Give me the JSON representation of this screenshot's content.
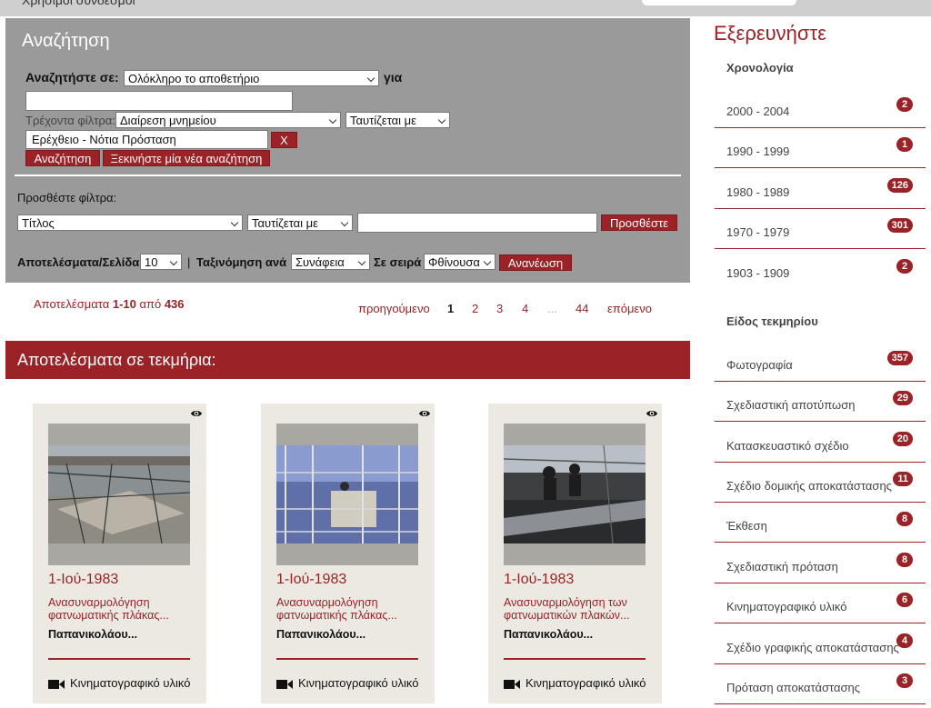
{
  "top": {
    "cut_text": "Χρήσιμοι σύνδεσμοι"
  },
  "search": {
    "title": "Αναζήτηση",
    "search_in_label": "Αναζητήστε σε:",
    "search_in_value": "Ολόκληρο το αποθετήριο",
    "for_label": "για",
    "query_value": "",
    "current_filters_label": "Τρέχοντα φίλτρα:",
    "filter_field_value": "Διαίρεση μνημείου",
    "filter_op_value": "Ταυτίζεται με",
    "filter_value": "Ερέχθειο - Νότια Πρόσταση",
    "remove_filter_label": "X",
    "search_button": "Αναζήτηση",
    "new_search_button": "Ξεκινήστε μία νέα αναζήτηση",
    "add_filters_label": "Προσθέστε φίλτρα:",
    "add_field_value": "Τίτλος",
    "add_op_value": "Ταυτίζεται με",
    "add_value": "",
    "add_button": "Προσθέστε",
    "rpp_label": "Αποτελέσματα/Σελίδα",
    "rpp_value": "10",
    "separator": "|",
    "sort_label": "Ταξινόμηση ανά",
    "sort_value": "Συνάφεια",
    "order_label": "Σε σειρά",
    "order_value": "Φθίνουσα",
    "refresh_button": "Ανανέωση"
  },
  "results": {
    "prefix": "Αποτελέσματα ",
    "range": "1-10",
    "of": " από ",
    "total": "436"
  },
  "pagination": {
    "prev": "προηγούμενο",
    "pages": [
      "1",
      "2",
      "3",
      "4",
      "...",
      "44"
    ],
    "current": "1",
    "next": "επόμενο"
  },
  "results_header": "Αποτελέσματα σε τεκμήρια:",
  "cards": [
    {
      "date": "1-Ιού-1983",
      "title": "Ανασυναρμολόγηση φατνωματικής πλάκας...",
      "author": "Παπανικολάου...",
      "type": "Κινηματογραφικό υλικό"
    },
    {
      "date": "1-Ιού-1983",
      "title": "Ανασυναρμολόγηση φατνωματικής πλάκας...",
      "author": "Παπανικολάου...",
      "type": "Κινηματογραφικό υλικό"
    },
    {
      "date": "1-Ιού-1983",
      "title": "Ανασυναρμολόγηση των φατνωματικών πλακών...",
      "author": "Παπανικολάου...",
      "type": "Κινηματογραφικό υλικό"
    }
  ],
  "explore": {
    "title": "Εξερευνήστε",
    "chronology": {
      "heading": "Χρονολογία",
      "items": [
        {
          "label": "2000 - 2004",
          "count": "2"
        },
        {
          "label": "1990 - 1999",
          "count": "1"
        },
        {
          "label": "1980 - 1989",
          "count": "126"
        },
        {
          "label": "1970 - 1979",
          "count": "301"
        },
        {
          "label": "1903 - 1909",
          "count": "2"
        }
      ]
    },
    "item_type": {
      "heading": "Είδος τεκμηρίου",
      "items": [
        {
          "label": "Φωτογραφία",
          "count": "357"
        },
        {
          "label": "Σχεδιαστική αποτύπωση",
          "count": "29"
        },
        {
          "label": "Κατασκευαστικό σχέδιο",
          "count": "20"
        },
        {
          "label": "Σχέδιο δομικής αποκατάστασης",
          "count": "11"
        },
        {
          "label": "Έκθεση",
          "count": "8"
        },
        {
          "label": "Σχεδιαστική πρόταση",
          "count": "8"
        },
        {
          "label": "Κινηματογραφικό υλικό",
          "count": "6"
        },
        {
          "label": "Σχέδιο γραφικής αποκατάστασης",
          "count": "4"
        },
        {
          "label": "Πρόταση αποκατάστασης",
          "count": "3"
        }
      ]
    }
  },
  "colors": {
    "accent": "#9b2226",
    "panel": "#9a9a9a",
    "card_bg": "#ece9e2"
  }
}
